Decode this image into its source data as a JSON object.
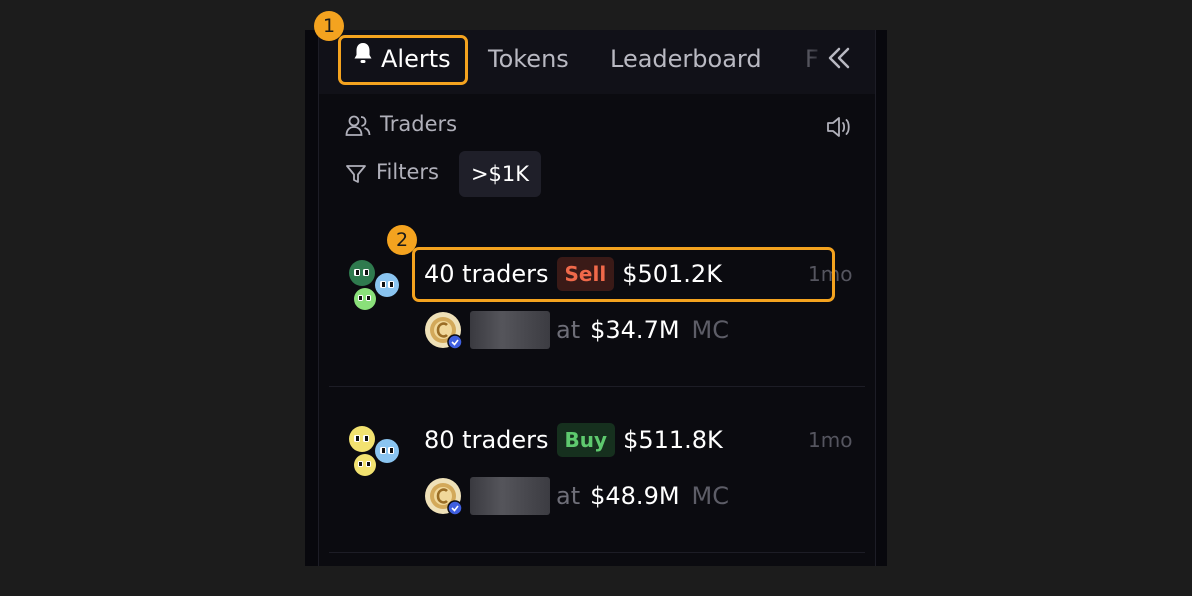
{
  "tabs": [
    {
      "label": "Alerts",
      "active": true,
      "icon": "bell-icon"
    },
    {
      "label": "Tokens"
    },
    {
      "label": "Leaderboard"
    },
    {
      "label": "F"
    }
  ],
  "collapse_icon": "double-chevron-left-icon",
  "annotations": [
    "1",
    "2"
  ],
  "traders_section": {
    "label": "Traders",
    "icon": "users-icon",
    "sound_icon": "speaker-icon"
  },
  "filters": {
    "label": "Filters",
    "icon": "funnel-icon",
    "active_chip": ">$1K"
  },
  "alerts": [
    {
      "traders": "40 traders",
      "side": "Sell",
      "amount": "$501.2K",
      "time": "1mo",
      "at": "at",
      "market_cap": "$34.7M",
      "mc_label": "MC"
    },
    {
      "traders": "80 traders",
      "side": "Buy",
      "amount": "$511.8K",
      "time": "1mo",
      "at": "at",
      "market_cap": "$48.9M",
      "mc_label": "MC"
    }
  ],
  "colors": {
    "highlight": "#f4a31f",
    "sell": "#f0694a",
    "buy": "#5ec96e",
    "background": "#0b0b10"
  }
}
